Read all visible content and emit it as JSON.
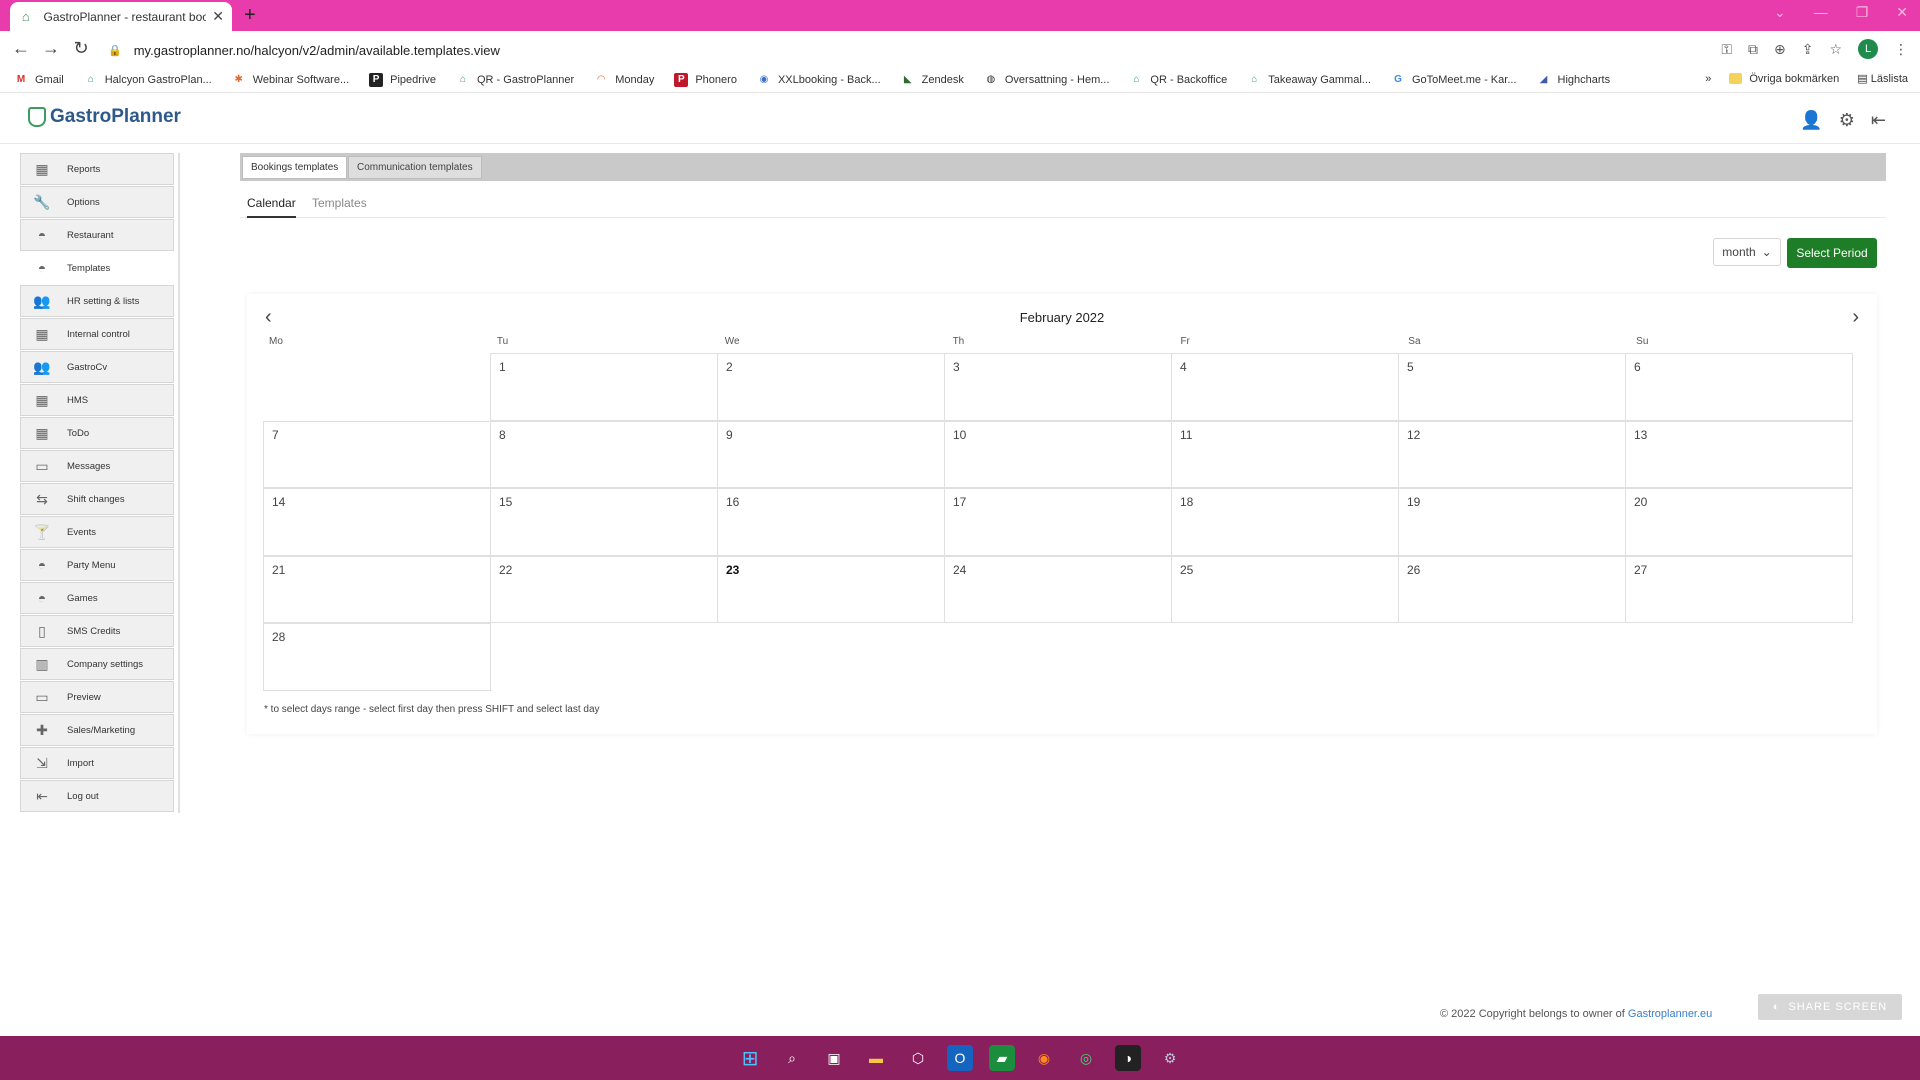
{
  "browser": {
    "tab_title": "GastroPlanner - restaurant book",
    "url": "my.gastroplanner.no/halcyon/v2/admin/available.templates.view",
    "profile_initial": "L",
    "bookmarks": [
      "Gmail",
      "Halcyon GastroPlan...",
      "Webinar Software...",
      "Pipedrive",
      "QR - GastroPlanner",
      "Monday",
      "Phonero",
      "XXLbooking - Back...",
      "Zendesk",
      "Oversattning - Hem...",
      "QR - Backoffice",
      "Takeaway Gammal...",
      "GoToMeet.me - Kar...",
      "Highcharts"
    ],
    "bookmarks_more": "»",
    "other_bookmarks": "Övriga bokmärken",
    "reading_list": "Läslista"
  },
  "app": {
    "logo": "GastroPlanner"
  },
  "sidebar": {
    "items": [
      {
        "label": "Reports",
        "icon": "reports-icon"
      },
      {
        "label": "Options",
        "icon": "wrench-icon"
      },
      {
        "label": "Restaurant",
        "icon": "cloche-icon"
      },
      {
        "label": "Templates",
        "icon": "cloche-icon"
      },
      {
        "label": "HR setting & lists",
        "icon": "people-icon"
      },
      {
        "label": "Internal control",
        "icon": "reports-icon"
      },
      {
        "label": "GastroCv",
        "icon": "people-icon"
      },
      {
        "label": "HMS",
        "icon": "reports-icon"
      },
      {
        "label": "ToDo",
        "icon": "reports-icon"
      },
      {
        "label": "Messages",
        "icon": "messages-icon"
      },
      {
        "label": "Shift changes",
        "icon": "shift-icon"
      },
      {
        "label": "Events",
        "icon": "cocktail-icon"
      },
      {
        "label": "Party Menu",
        "icon": "cloche-icon"
      },
      {
        "label": "Games",
        "icon": "cloche-icon"
      },
      {
        "label": "SMS Credits",
        "icon": "phone-icon"
      },
      {
        "label": "Company settings",
        "icon": "building-icon"
      },
      {
        "label": "Preview",
        "icon": "monitor-icon"
      },
      {
        "label": "Sales/Marketing",
        "icon": "puzzle-icon"
      },
      {
        "label": "Import",
        "icon": "import-icon"
      },
      {
        "label": "Log out",
        "icon": "logout-icon"
      }
    ]
  },
  "main": {
    "tabs": [
      "Bookings templates",
      "Communication templates"
    ],
    "subtabs": [
      "Calendar",
      "Templates"
    ],
    "view_select": "month",
    "select_period": "Select Period"
  },
  "calendar": {
    "title": "February 2022",
    "weekdays": [
      "Mo",
      "Tu",
      "We",
      "Th",
      "Fr",
      "Sa",
      "Su"
    ],
    "weeks": [
      [
        "",
        "1",
        "2",
        "3",
        "4",
        "5",
        "6"
      ],
      [
        "7",
        "8",
        "9",
        "10",
        "11",
        "12",
        "13"
      ],
      [
        "14",
        "15",
        "16",
        "17",
        "18",
        "19",
        "20"
      ],
      [
        "21",
        "22",
        "23",
        "24",
        "25",
        "26",
        "27"
      ],
      [
        "28",
        "",
        "",
        "",
        "",
        "",
        ""
      ]
    ],
    "today": "23",
    "note": "* to select days range - select first day then press SHIFT and select last day"
  },
  "footer": {
    "copyright": "© 2022 Copyright belongs to owner of ",
    "link": "Gastroplanner.eu",
    "share_screen": "SHARE SCREEN"
  },
  "colors": {
    "tabstrip": "#e93cac",
    "taskbar": "#8a1f5e",
    "primary_button": "#1e7e27"
  }
}
